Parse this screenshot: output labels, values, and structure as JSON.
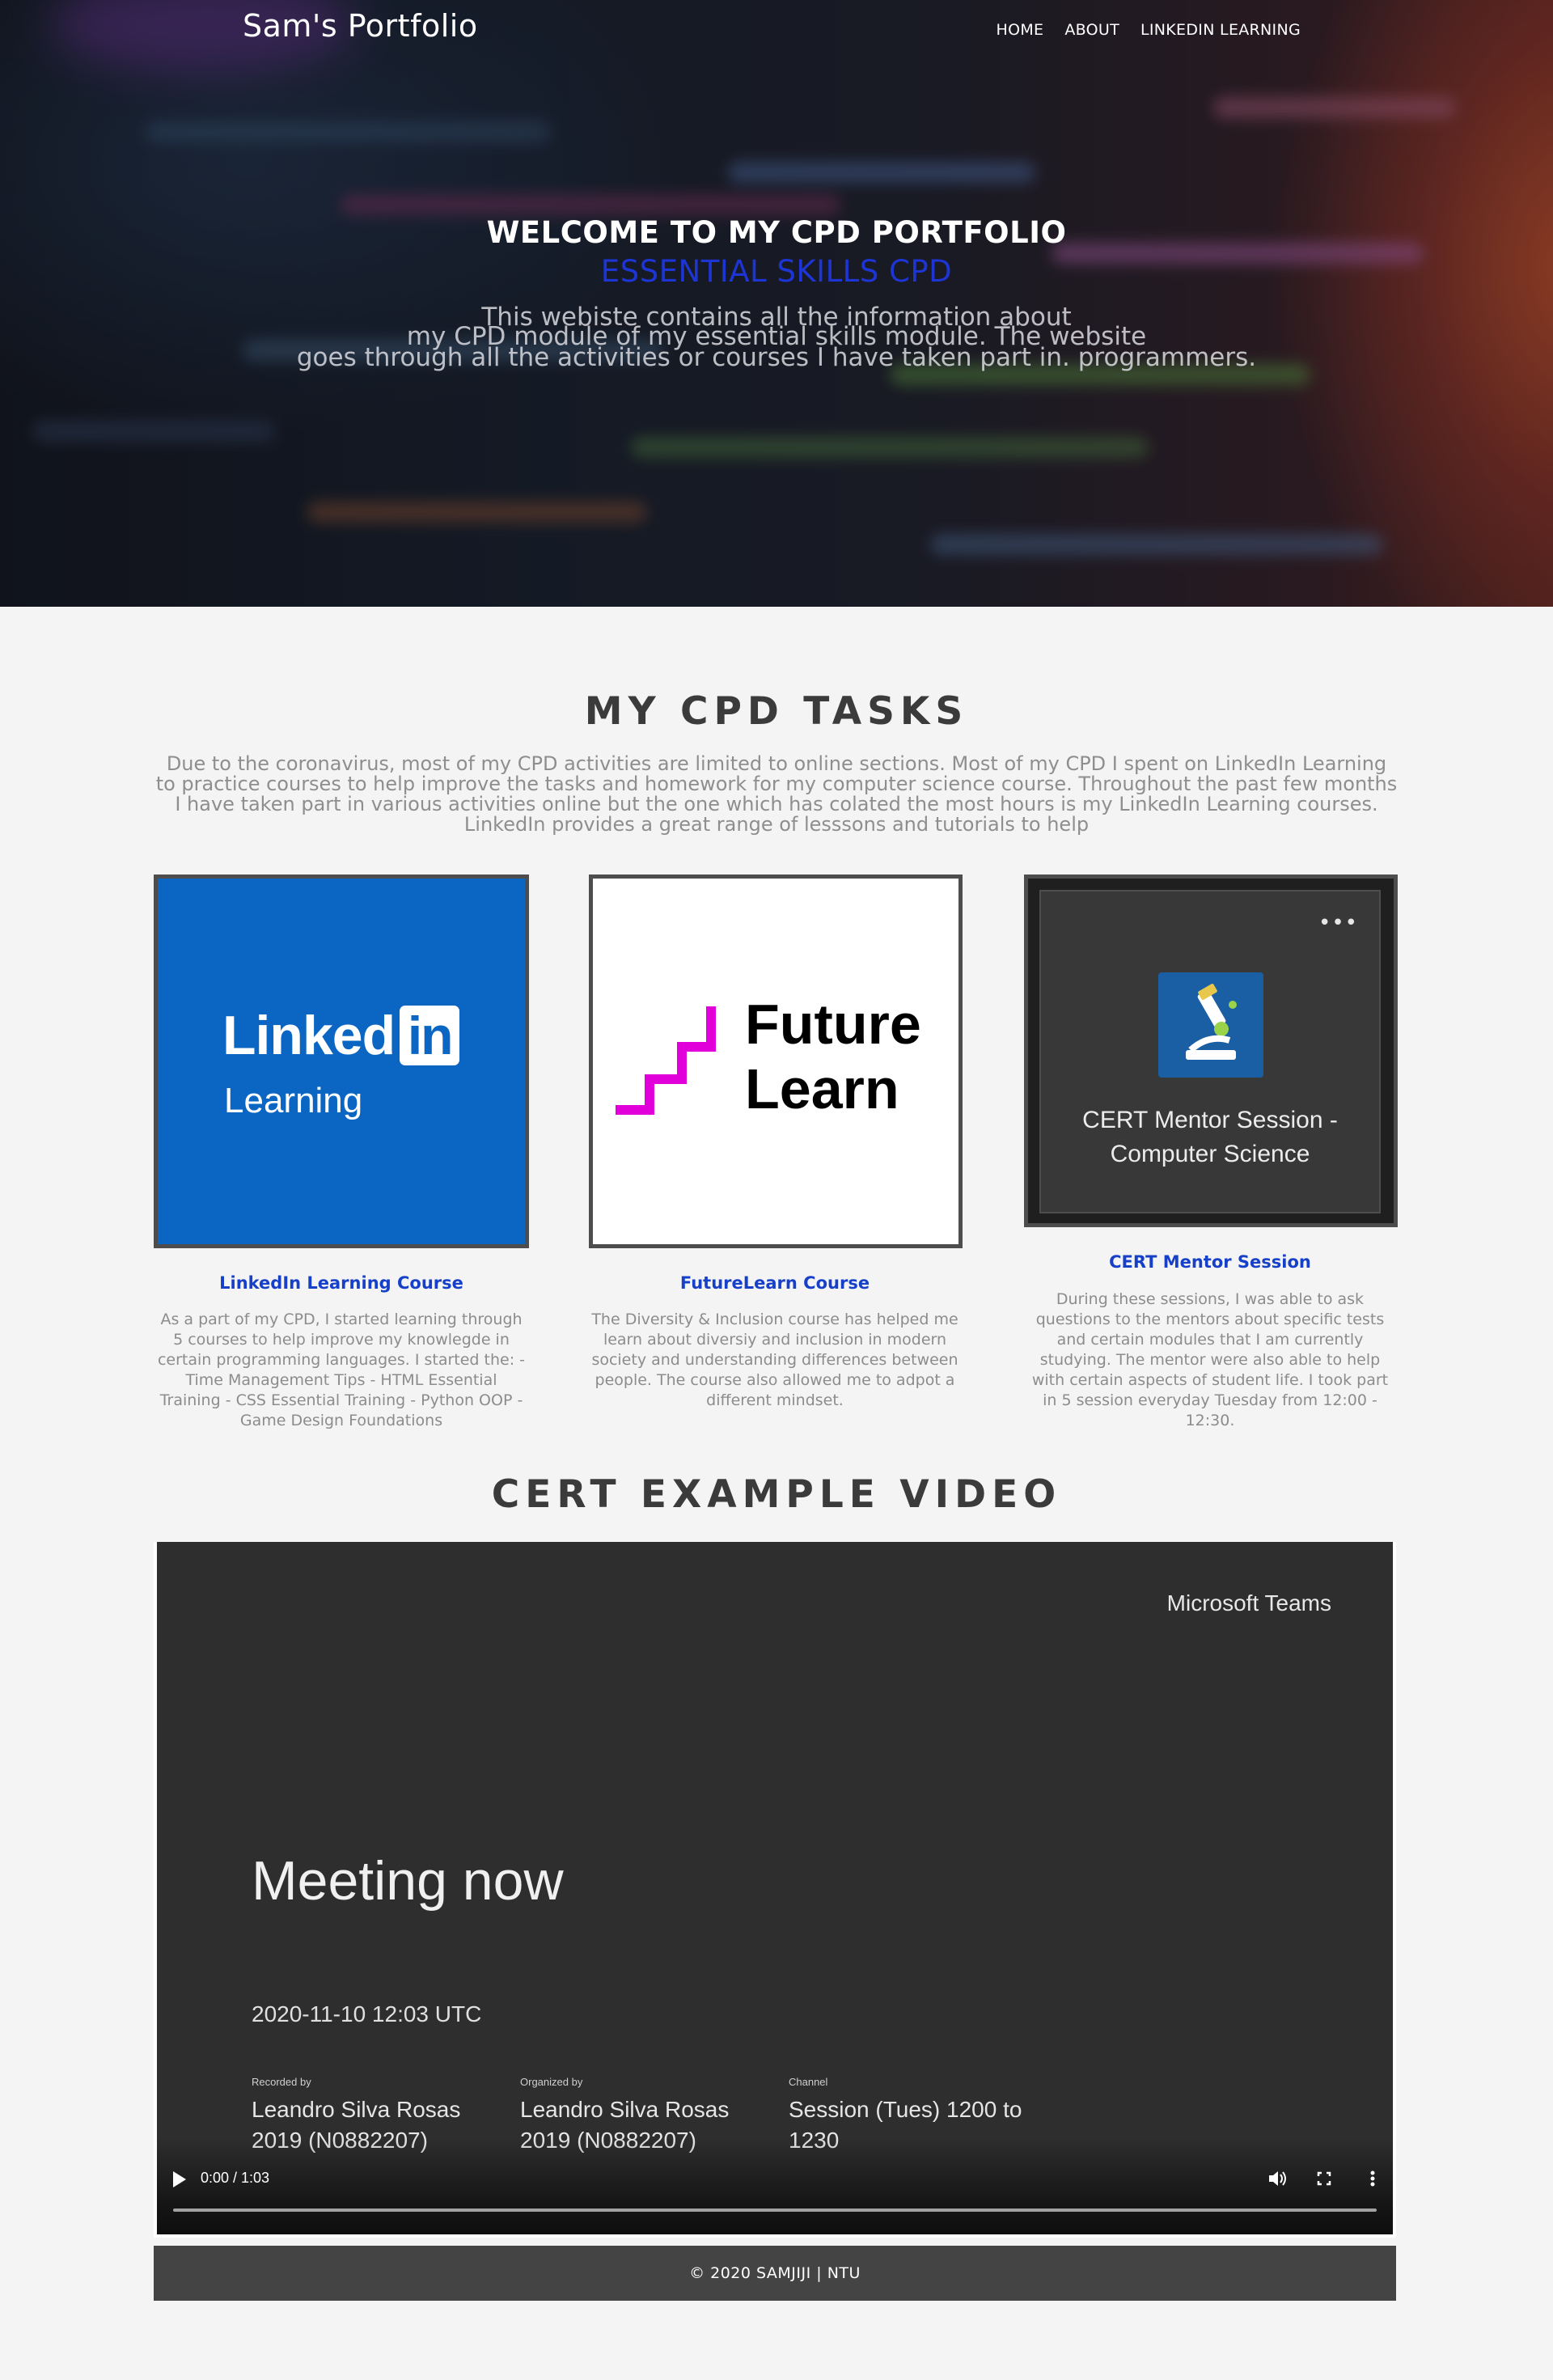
{
  "header": {
    "brand": "Sam's Portfolio",
    "nav": [
      "HOME",
      "ABOUT",
      "LINKEDIN LEARNING"
    ]
  },
  "hero": {
    "title": "WELCOME TO MY CPD PORTFOLIO",
    "subtitle": "ESSENTIAL SKILLS CPD",
    "overlapping_text_lines": [
      "This webiste contains all the information about",
      "my CPD module of my essential skills module. The website",
      "goes through all the activities or courses I have taken part in. programmers."
    ]
  },
  "tasks": {
    "title": "MY CPD TASKS",
    "intro": "Due to the coronavirus, most of my CPD activities are limited to online sections. Most of my CPD I spent on LinkedIn Learning to practice courses to help improve the tasks and homework for my computer science course. Throughout the past few months I have taken part in various activities online but the one which has colated the most hours is my LinkedIn Learning courses. LinkedIn provides a great range of lesssons and tutorials to help",
    "cards": [
      {
        "logo": {
          "line1": "Linked",
          "badge": "in",
          "line2": "Learning"
        },
        "heading": "LinkedIn Learning Course",
        "text": "As a part of my CPD, I started learning through 5 courses to help improve my knowlegde in certain programming languages. I started the: - Time Management Tips - HTML Essential Training - CSS Essential Training - Python OOP - Game Design Foundations"
      },
      {
        "logo": {
          "line1": "Future",
          "line2": "Learn"
        },
        "heading": "FutureLearn Course",
        "text": "The Diversity & Inclusion course has helped me learn about diversiy and inclusion in modern society and understanding differences between people. The course also allowed me to adpot a different mindset."
      },
      {
        "logo": {
          "dots": "•••",
          "label": "CERT Mentor Session - Computer Science",
          "icon": "microscope-icon"
        },
        "heading": "CERT Mentor Session",
        "text": "During these sessions, I was able to ask questions to the mentors about specific tests and certain modules that I am currently studying. The mentor were also able to help with certain aspects of student life. I took part in 5 session everyday Tuesday from 12:00 - 12:30."
      }
    ]
  },
  "video_section": {
    "title": "CERT EXAMPLE VIDEO",
    "frame": {
      "app": "Microsoft Teams",
      "headline": "Meeting now",
      "timestamp": "2020-11-10 12:03 UTC",
      "columns": [
        {
          "label": "Recorded by",
          "value": "Leandro Silva Rosas 2019 (N0882207)"
        },
        {
          "label": "Organized by",
          "value": "Leandro Silva Rosas 2019 (N0882207)"
        },
        {
          "label": "Channel",
          "value": "Session (Tues) 1200 to 1230"
        }
      ]
    },
    "controls": {
      "time": "0:00 / 1:03",
      "progress": 0.0
    }
  },
  "footer": {
    "text": "© 2020 SAMJIJI | NTU"
  },
  "colors": {
    "accent_blue": "#1e35d6",
    "link_blue": "#1740c8",
    "linkedin_blue": "#0a66c2",
    "futurelearn_magenta": "#de00d4",
    "page_bg": "#f4f4f4",
    "footer_bg": "#444444"
  }
}
